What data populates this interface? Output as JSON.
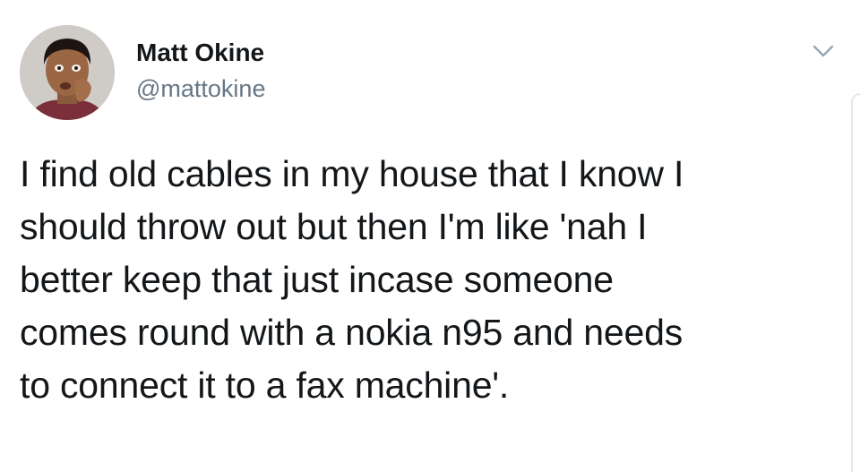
{
  "author": {
    "display_name": "Matt Okine",
    "handle": "@mattokine",
    "avatar_icon": "profile-photo"
  },
  "menu": {
    "icon": "chevron-down-icon"
  },
  "tweet": {
    "lines": [
      "I find old cables in my house that I know I",
      "should throw out but then I'm like 'nah I",
      "better keep that just incase someone",
      "comes round with a nokia n95 and needs",
      "to connect it to a fax machine'."
    ]
  },
  "colors": {
    "text_primary": "#14171a",
    "text_secondary": "#657786",
    "divider": "#e1e8ed"
  }
}
